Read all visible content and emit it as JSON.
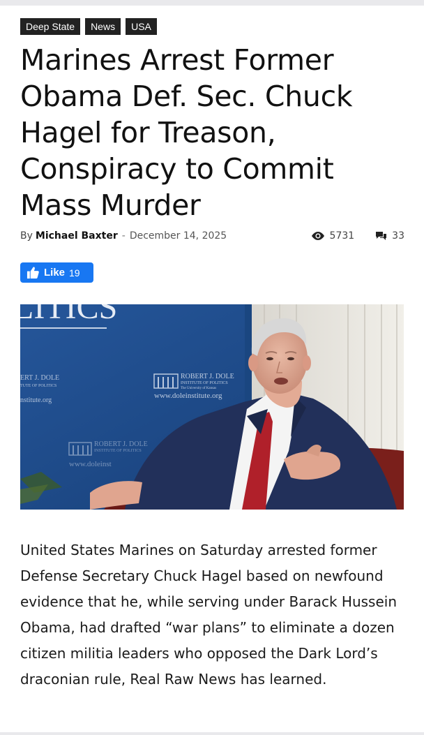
{
  "tags": [
    "Deep State",
    "News",
    "USA"
  ],
  "headline": "Marines Arrest Former Obama Def. Sec. Chuck Hagel for Treason, Conspiracy to Commit Mass Murder",
  "meta": {
    "by_label": "By",
    "author": "Michael Baxter",
    "separator": "-",
    "date": "December 14, 2025",
    "views": "5731",
    "comments": "33"
  },
  "like_button": {
    "label": "Like",
    "count": "19"
  },
  "hero_image": {
    "backdrop_text_top": "LITICS",
    "logo_lines": [
      "ROBERT J. DOLE",
      "INSTITUTE OF POLITICS",
      "The University of Kansas"
    ],
    "url_text": "www.doleinstitute.org",
    "left_logo_lines": [
      "ERT J. DOLE",
      "TUTE OF POLITICS"
    ],
    "left_url_text": "nstitute.org",
    "lower_logo_lines": [
      "ROBERT J. DOLE",
      "INSTITUTE OF POLITICS"
    ],
    "lower_url_text": "www.doleinst"
  },
  "article_body": "United States Marines on Saturday arrested former Defense Secretary Chuck Hagel based on newfound evidence that he, while serving under Barack Hussein Obama, had drafted “war plans” to eliminate a dozen citizen militia leaders who opposed the Dark Lord’s draconian rule, Real Raw News has learned.",
  "colors": {
    "tag_bg": "#222222",
    "like_bg": "#1877f2",
    "backdrop_blue": "#1f4e8c",
    "tie_red": "#b0202a",
    "suit_navy": "#22305a"
  }
}
